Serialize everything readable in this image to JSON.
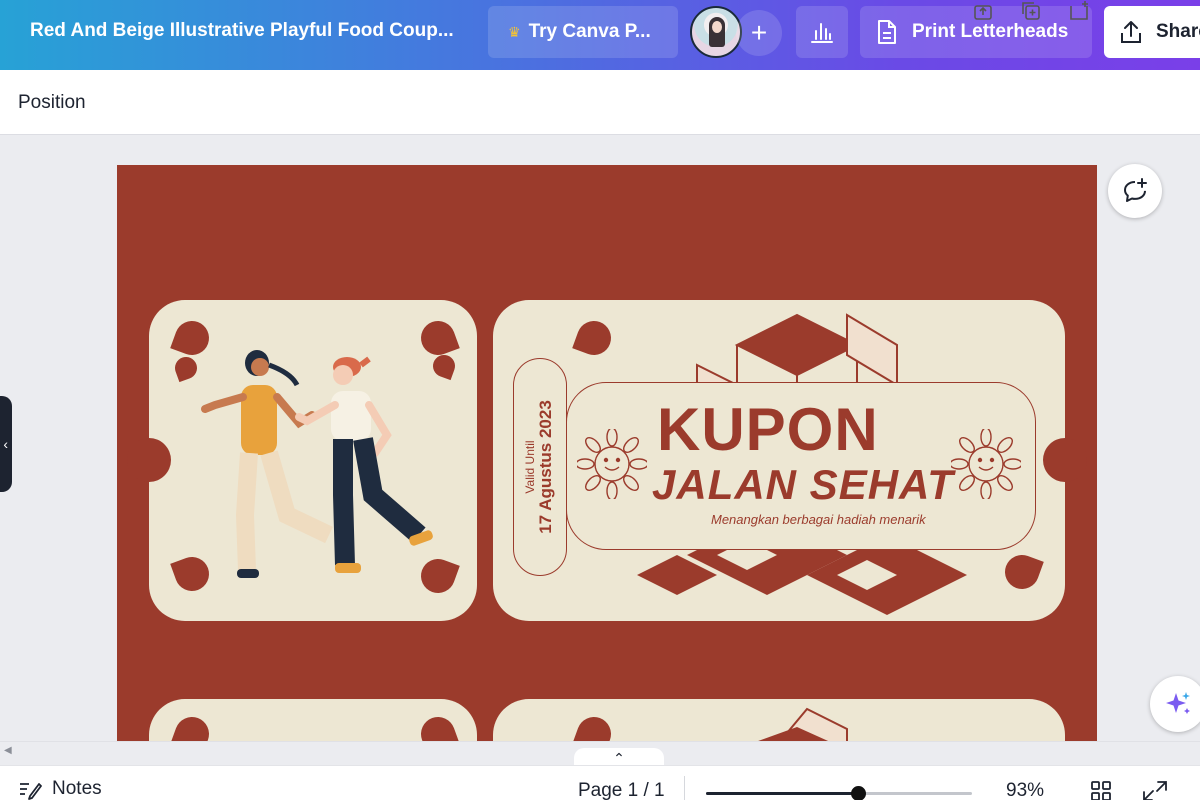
{
  "header": {
    "doc_title": "Red And Beige Illustrative Playful Food Coup...",
    "try_pro_label": "Try Canva P...",
    "add_label": "+",
    "print_label": "Print Letterheads",
    "share_label": "Share"
  },
  "context_bar": {
    "position_label": "Position"
  },
  "coupon": {
    "valid_label": "Valid Until",
    "valid_date": "17 Agustus 2023",
    "title": "KUPON",
    "subtitle": "JALAN SEHAT",
    "tagline": "Menangkan berbagai hadiah menarik"
  },
  "footer": {
    "notes_label": "Notes",
    "page_indicator": "Page 1 / 1",
    "zoom_value": "93%",
    "zoom_fraction": 0.57
  },
  "colors": {
    "brand_gradient_start": "#27a2d6",
    "brand_gradient_end": "#7a3fe8",
    "coupon_red": "#9b3b2c",
    "coupon_beige": "#ede7d3"
  },
  "icons": [
    "crown-icon",
    "stats-icon",
    "document-icon",
    "share-upload-icon",
    "add-comment-icon",
    "magic-sparkle-icon",
    "notes-pencil-icon",
    "grid-view-icon",
    "fullscreen-icon"
  ]
}
